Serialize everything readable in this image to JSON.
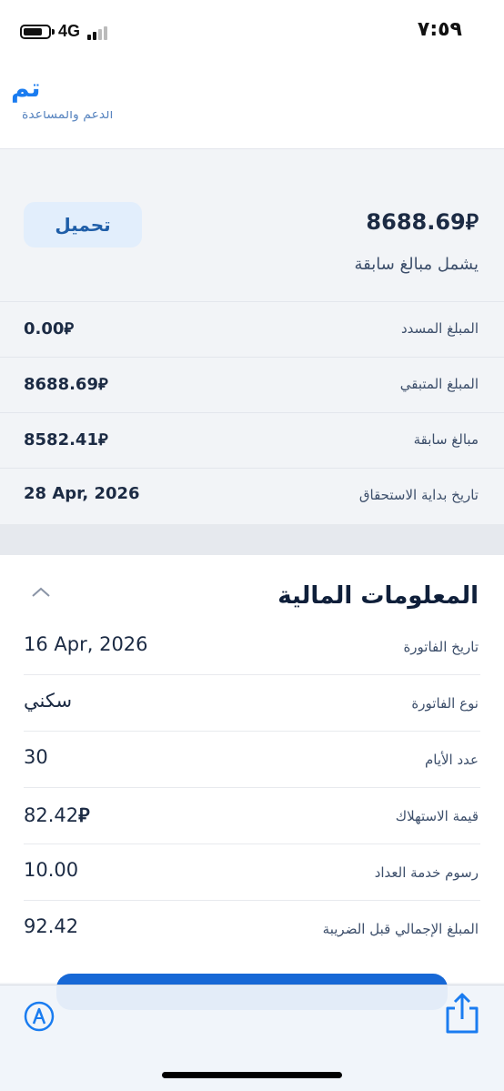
{
  "status_bar": {
    "network": "4G",
    "time": "٧:٥٩"
  },
  "nav": {
    "done_label": "تم"
  },
  "top_card": {
    "support_label": "الدعم والمساعدة"
  },
  "summary": {
    "download_label": "تحميل",
    "total_amount": "8688.69",
    "currency_symbol": "⃁",
    "includes_label": "يشمل مبالغ سابقة",
    "rows": [
      {
        "label": "المبلغ المسدد",
        "value": "0.00"
      },
      {
        "label": "المبلغ المتبقي",
        "value": "8688.69"
      },
      {
        "label": "مبالغ سابقة",
        "value": "8582.41"
      },
      {
        "label": "تاريخ بداية الاستحقاق",
        "value": "28 Apr, 2026"
      }
    ]
  },
  "financial": {
    "title": "المعلومات المالية",
    "rows": [
      {
        "label": "تاريخ الفاتورة",
        "value": "16 Apr, 2026"
      },
      {
        "label": "نوع الفاتورة",
        "value": "سكني"
      },
      {
        "label": "عدد الأيام",
        "value": "30"
      },
      {
        "label": "قيمة الاستهلاك",
        "value": "82.42"
      },
      {
        "label": "رسوم خدمة العداد",
        "value": "10.00"
      },
      {
        "label": "المبلغ الإجمالي قبل الضريبة",
        "value": "92.42"
      }
    ]
  },
  "colors": {
    "accent": "#1a7cf0",
    "button_bg": "#e2eefc",
    "primary_button": "#1768d6"
  },
  "icons": [
    "battery-icon",
    "signal-icon",
    "chevron-up-icon",
    "compass-icon",
    "share-icon"
  ]
}
